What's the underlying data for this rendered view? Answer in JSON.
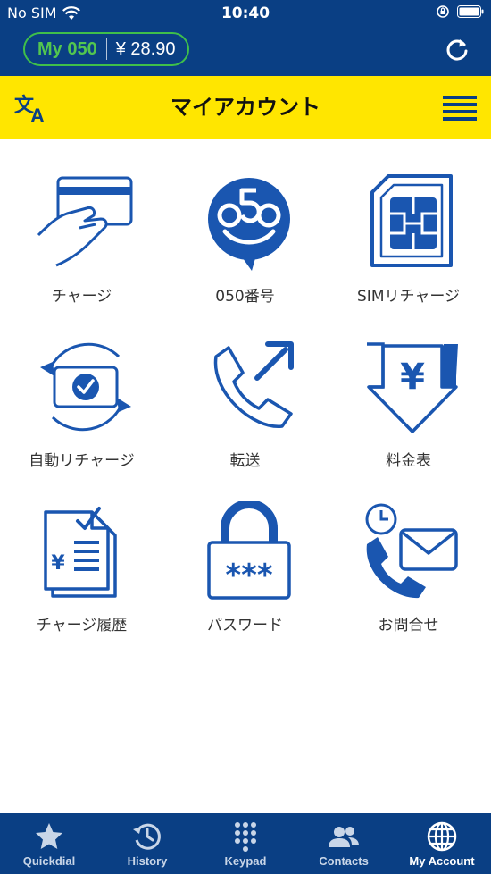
{
  "status_bar": {
    "carrier": "No SIM",
    "time": "10:40"
  },
  "header": {
    "brand": "My 050",
    "balance": "¥ 28.90"
  },
  "title_bar": {
    "title": "マイアカウント"
  },
  "menu": [
    {
      "label": "チャージ",
      "icon": "credit-card-hand-icon"
    },
    {
      "label": "050番号",
      "icon": "050-logo-icon"
    },
    {
      "label": "SIMリチャージ",
      "icon": "sim-card-icon"
    },
    {
      "label": "自動リチャージ",
      "icon": "auto-recharge-icon"
    },
    {
      "label": "転送",
      "icon": "call-forward-icon"
    },
    {
      "label": "料金表",
      "icon": "yen-price-icon"
    },
    {
      "label": "チャージ履歴",
      "icon": "charge-history-icon"
    },
    {
      "label": "パスワード",
      "icon": "padlock-icon"
    },
    {
      "label": "お問合せ",
      "icon": "contact-icon"
    }
  ],
  "tabs": [
    {
      "label": "Quickdial",
      "icon": "star-icon"
    },
    {
      "label": "History",
      "icon": "history-icon"
    },
    {
      "label": "Keypad",
      "icon": "keypad-icon"
    },
    {
      "label": "Contacts",
      "icon": "contacts-icon"
    },
    {
      "label": "My Account",
      "icon": "globe-icon",
      "active": true
    }
  ],
  "colors": {
    "primary_blue": "#0a3f84",
    "accent_yellow": "#ffe600",
    "brand_green": "#53c64f",
    "icon_blue": "#1a56b0"
  }
}
